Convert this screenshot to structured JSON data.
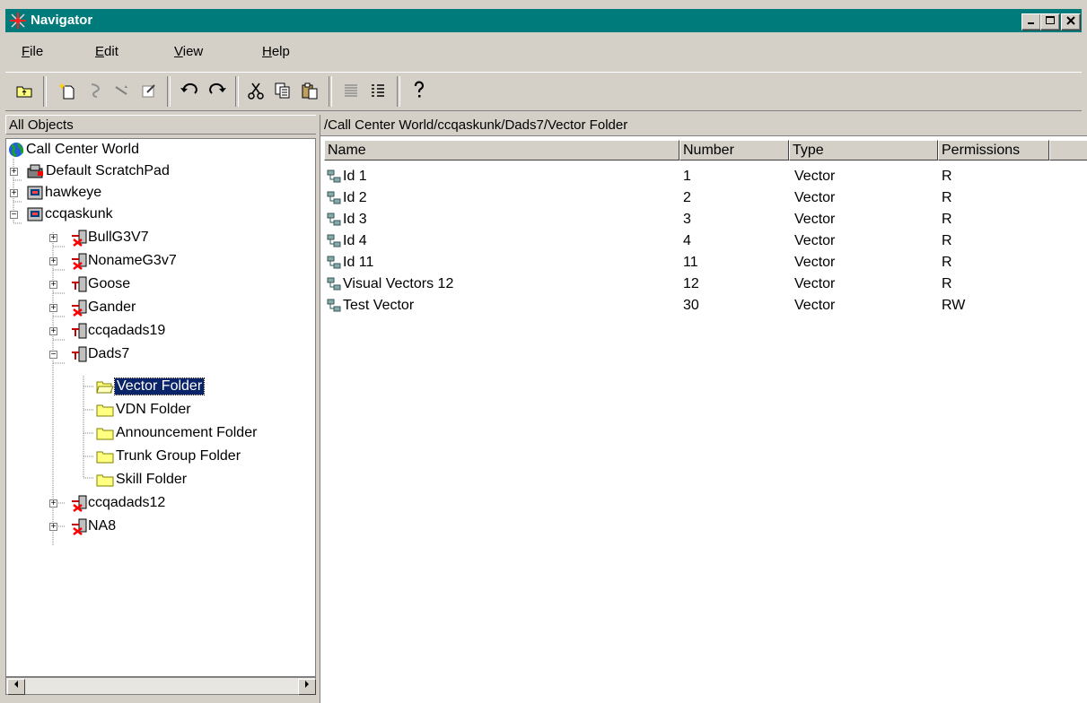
{
  "window": {
    "title": "Navigator"
  },
  "menu": [
    {
      "label": "File",
      "mnemonic": "F"
    },
    {
      "label": "Edit",
      "mnemonic": "E"
    },
    {
      "label": "View",
      "mnemonic": "V"
    },
    {
      "label": "Help",
      "mnemonic": "H"
    }
  ],
  "toolbar": [
    "up-folder-icon",
    "new-icon",
    "properties-icon",
    "wand-icon",
    "edit-icon",
    "undo-icon",
    "redo-icon",
    "cut-icon",
    "copy-icon",
    "paste-icon",
    "list-view-icon",
    "details-view-icon",
    "help-icon"
  ],
  "left": {
    "header": "All Objects",
    "tree": [
      {
        "label": "Call Center World",
        "icon": "globe-icon"
      },
      {
        "label": "Default ScratchPad",
        "icon": "scratchpad-icon"
      },
      {
        "label": "hawkeye",
        "icon": "server-icon"
      },
      {
        "label": "ccqaskunk",
        "icon": "server-icon"
      },
      {
        "label": "BullG3V7",
        "icon": "switch-down-icon"
      },
      {
        "label": "NonameG3v7",
        "icon": "switch-down-icon"
      },
      {
        "label": "Goose",
        "icon": "switch-icon"
      },
      {
        "label": "Gander",
        "icon": "switch-down-icon"
      },
      {
        "label": "ccqadads19",
        "icon": "switch-icon"
      },
      {
        "label": "Dads7",
        "icon": "switch-icon"
      },
      {
        "label": "Vector Folder",
        "icon": "folder-icon"
      },
      {
        "label": "VDN Folder",
        "icon": "folder-icon"
      },
      {
        "label": "Announcement Folder",
        "icon": "folder-icon"
      },
      {
        "label": "Trunk Group Folder",
        "icon": "folder-icon"
      },
      {
        "label": "Skill Folder",
        "icon": "folder-icon"
      },
      {
        "label": "ccqadads12",
        "icon": "switch-down-icon"
      },
      {
        "label": "NA8",
        "icon": "switch-down-icon"
      }
    ]
  },
  "right": {
    "path": "/Call Center World/ccqaskunk/Dads7/Vector Folder",
    "columns": [
      "Name",
      "Number",
      "Type",
      "Permissions"
    ],
    "rows": [
      {
        "name": "Id 1",
        "number": "1",
        "type": "Vector",
        "perm": "R"
      },
      {
        "name": "Id 2",
        "number": "2",
        "type": "Vector",
        "perm": "R"
      },
      {
        "name": "Id 3",
        "number": "3",
        "type": "Vector",
        "perm": "R"
      },
      {
        "name": "Id 4",
        "number": "4",
        "type": "Vector",
        "perm": "R"
      },
      {
        "name": "Id 11",
        "number": "11",
        "type": "Vector",
        "perm": "R"
      },
      {
        "name": "Visual Vectors 12",
        "number": "12",
        "type": "Vector",
        "perm": "R"
      },
      {
        "name": "Test Vector",
        "number": "30",
        "type": "Vector",
        "perm": "RW"
      }
    ]
  },
  "colors": {
    "title_bar": "#007b7b",
    "selection": "#0a246a",
    "face": "#d4d0c8"
  }
}
